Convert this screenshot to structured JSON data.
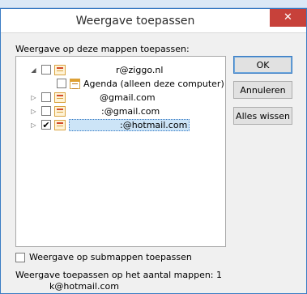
{
  "dialog": {
    "title": "Weergave toepassen",
    "close_symbol": "✕"
  },
  "tree": {
    "label": "Weergave op deze mappen toepassen:",
    "items": [
      {
        "label": "r@ziggo.nl",
        "expander": "◢",
        "checked": false,
        "icon": "mail-folder-icon"
      },
      {
        "label": "Agenda (alleen deze computer)",
        "expander": "",
        "checked": false,
        "icon": "calendar-icon"
      },
      {
        "label": "@gmail.com",
        "expander": "▷",
        "checked": false,
        "icon": "mail-folder-icon"
      },
      {
        "label": ":@gmail.com",
        "expander": "▷",
        "checked": false,
        "icon": "mail-folder-icon"
      },
      {
        "label": ":@hotmail.com",
        "expander": "▷",
        "checked": true,
        "icon": "mail-folder-icon"
      }
    ],
    "check_mark": "✔"
  },
  "buttons": {
    "ok": "OK",
    "cancel": "Annuleren",
    "clear_all": "Alles wissen"
  },
  "subfolders": {
    "label": "Weergave op submappen toepassen",
    "checked": false
  },
  "footer": {
    "count_text": "Weergave toepassen op het aantal mappen: 1",
    "folder_name": "k@hotmail.com"
  }
}
